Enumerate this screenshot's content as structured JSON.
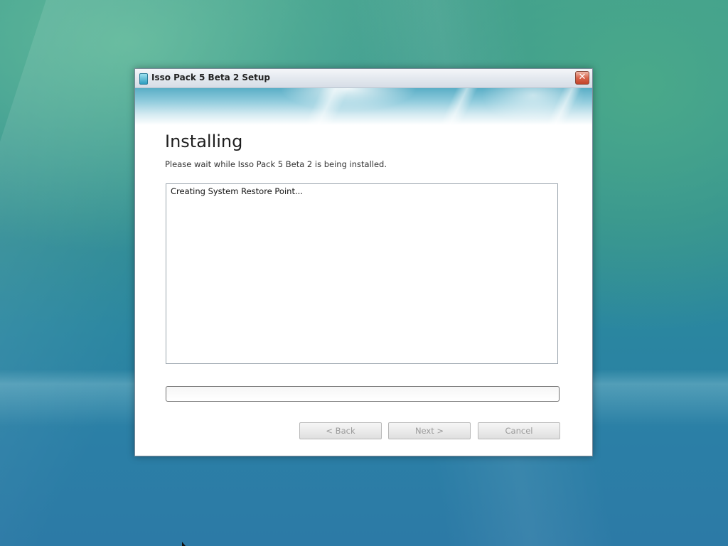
{
  "window": {
    "title": "Isso Pack 5 Beta 2 Setup",
    "icon": "installer-app-icon",
    "close_glyph": "✕"
  },
  "page": {
    "heading": "Installing",
    "subheading": "Please wait while Isso Pack 5 Beta 2 is being installed."
  },
  "log": {
    "lines": [
      "Creating System Restore Point..."
    ]
  },
  "progress": {
    "value_percent": 0
  },
  "buttons": {
    "back": "< Back",
    "next": "Next >",
    "cancel": "Cancel"
  },
  "colors": {
    "banner_accent": "#5aaec6",
    "progress_fill": "#37b12f"
  }
}
